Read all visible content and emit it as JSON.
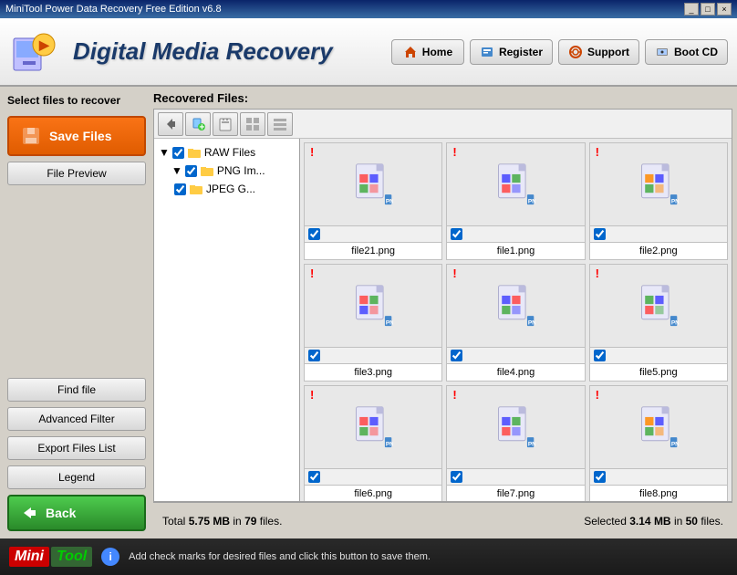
{
  "title_bar": {
    "text": "MiniTool Power Data Recovery Free Edition v6.8",
    "buttons": [
      "_",
      "□",
      "×"
    ]
  },
  "header": {
    "logo_text": "Digital Media Recovery",
    "nav_buttons": [
      {
        "label": "Home",
        "icon": "home"
      },
      {
        "label": "Register",
        "icon": "register"
      },
      {
        "label": "Support",
        "icon": "support"
      },
      {
        "label": "Boot CD",
        "icon": "bootcd"
      }
    ]
  },
  "sidebar": {
    "title": "Select files to recover",
    "save_btn": "Save Files",
    "file_preview_btn": "File Preview",
    "find_file_btn": "Find file",
    "advanced_filter_btn": "Advanced Filter",
    "export_files_btn": "Export Files List",
    "legend_btn": "Legend",
    "back_btn": "Back"
  },
  "content": {
    "header": "Recovered Files:",
    "tree": [
      {
        "label": "RAW Files",
        "level": 0,
        "checked": true,
        "type": "folder"
      },
      {
        "label": "PNG Im...",
        "level": 1,
        "checked": true,
        "type": "folder"
      },
      {
        "label": "JPEG G...",
        "level": 1,
        "checked": true,
        "type": "folder"
      }
    ],
    "toolbar_buttons": [
      "back",
      "add",
      "remove",
      "grid",
      "list"
    ],
    "files": [
      {
        "name": "file21.png",
        "checked": true,
        "has_warning": true
      },
      {
        "name": "file1.png",
        "checked": true,
        "has_warning": true
      },
      {
        "name": "file2.png",
        "checked": true,
        "has_warning": true
      },
      {
        "name": "file3.png",
        "checked": true,
        "has_warning": true
      },
      {
        "name": "file4.png",
        "checked": true,
        "has_warning": true
      },
      {
        "name": "file5.png",
        "checked": true,
        "has_warning": true
      },
      {
        "name": "file6.png",
        "checked": true,
        "has_warning": true
      },
      {
        "name": "file7.png",
        "checked": true,
        "has_warning": true
      },
      {
        "name": "file8.png",
        "checked": true,
        "has_warning": true
      }
    ]
  },
  "status": {
    "total_text": "Total ",
    "total_size": "5.75 MB",
    "total_mid": " in ",
    "total_files": "79",
    "total_end": " files.",
    "selected_text": "Selected ",
    "selected_size": "3.14 MB",
    "selected_mid": " in ",
    "selected_files": "50",
    "selected_end": " files."
  },
  "bottom_bar": {
    "logo_mini": "Mini",
    "logo_tool": "Tool",
    "message": "Add check marks for desired files and click this button to save them."
  },
  "colors": {
    "accent_orange": "#f97316",
    "accent_green": "#4ecb4e",
    "brand_blue": "#1a3a6a"
  }
}
